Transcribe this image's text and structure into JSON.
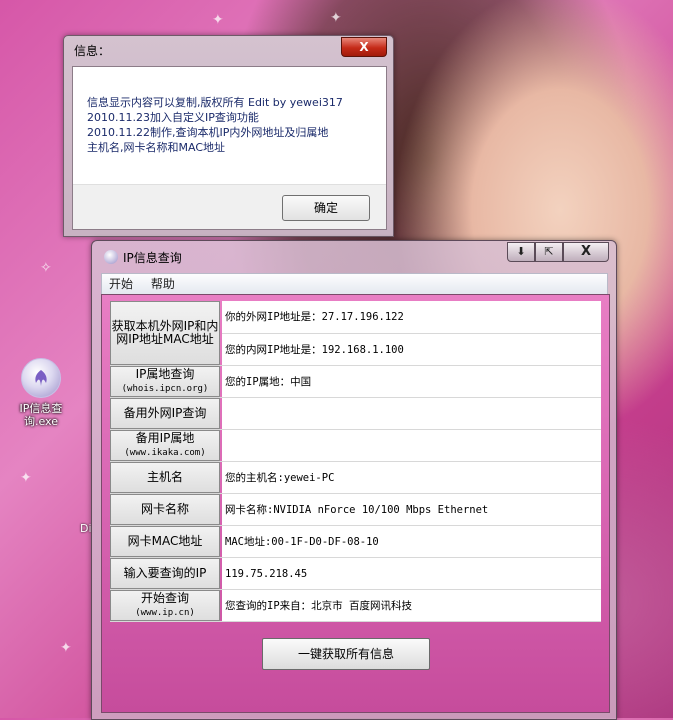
{
  "desktop": {
    "icon_label": "IP信息查询.exe",
    "peek_text": "Di"
  },
  "message_box": {
    "title": "信息：",
    "close_label": "X",
    "lines": [
      "信息显示内容可以复制,版权所有 Edit by yewei317",
      "2010.11.23加入自定义IP查询功能",
      "2010.11.22制作,查询本机IP内外网地址及归属地",
      "主机名,网卡名称和MAC地址"
    ],
    "ok_label": "确定"
  },
  "main_window": {
    "title": "IP信息查询",
    "controls": {
      "minimize": "⬇",
      "restore": "⇱",
      "close": "X"
    },
    "menu": [
      "开始",
      "帮助"
    ],
    "rows": {
      "get_ip": {
        "label": "获取本机外网IP和内网IP地址MAC地址",
        "external": "你的外网IP地址是：27.17.196.122",
        "internal": "您的内网IP地址是：192.168.1.100"
      },
      "ip_location": {
        "label": "IP属地查询",
        "sub": "(whois.ipcn.org)",
        "value": "您的IP属地：中国"
      },
      "backup_external": {
        "label": "备用外网IP查询",
        "value": ""
      },
      "backup_location": {
        "label": "备用IP属地",
        "sub": "(www.ikaka.com)",
        "value": ""
      },
      "hostname": {
        "label": "主机名",
        "value": "您的主机名:yewei-PC"
      },
      "nic": {
        "label": "网卡名称",
        "value": "网卡名称:NVIDIA nForce 10/100 Mbps Ethernet"
      },
      "mac": {
        "label": "网卡MAC地址",
        "value": "MAC地址:00-1F-D0-DF-08-10"
      },
      "query_input": {
        "label": "输入要查询的IP",
        "value": "119.75.218.45"
      },
      "start_query": {
        "label": "开始查询",
        "sub": "(www.ip.cn)",
        "value": "您查询的IP来自：北京市 百度网讯科技"
      }
    },
    "get_all_label": "一键获取所有信息"
  }
}
